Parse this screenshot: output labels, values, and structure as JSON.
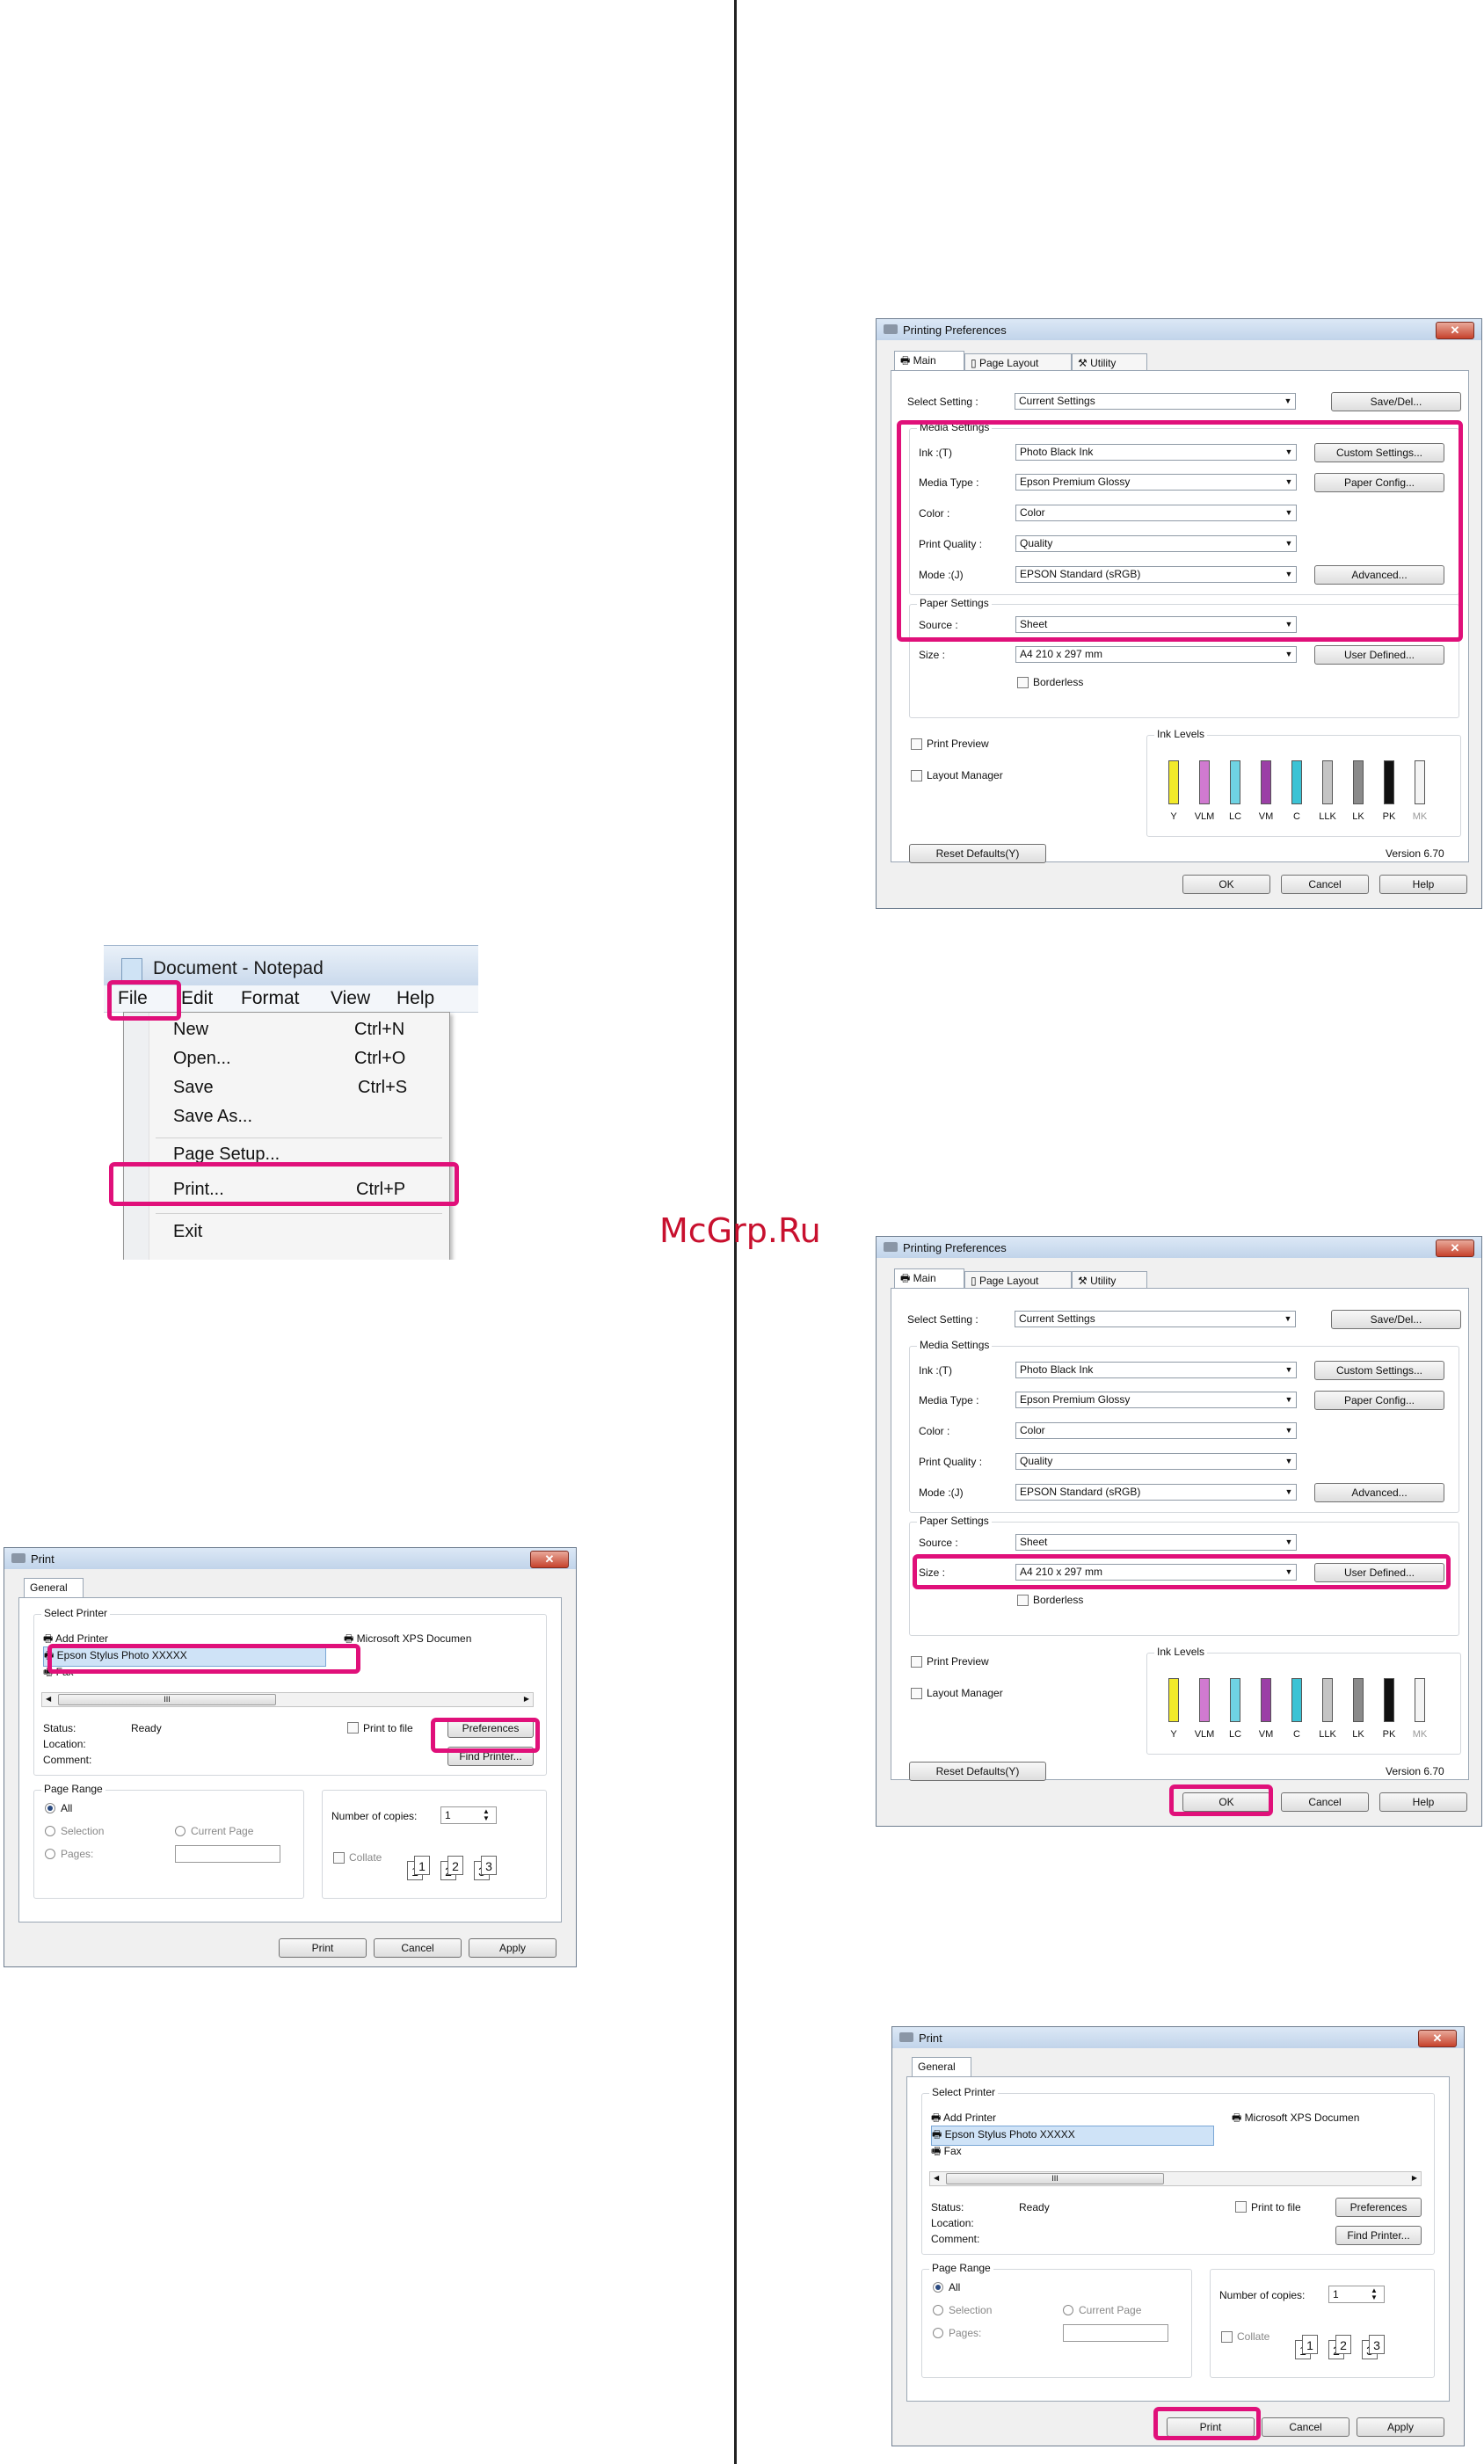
{
  "watermark": "McGrp.Ru",
  "notepad": {
    "title": "Document - Notepad",
    "menus": [
      "File",
      "Edit",
      "Format",
      "View",
      "Help"
    ],
    "items": [
      {
        "label": "New",
        "shortcut": "Ctrl+N"
      },
      {
        "label": "Open...",
        "shortcut": "Ctrl+O"
      },
      {
        "label": "Save",
        "shortcut": "Ctrl+S"
      },
      {
        "label": "Save As...",
        "shortcut": ""
      },
      {
        "label": "Page Setup...",
        "shortcut": ""
      },
      {
        "label": "Print...",
        "shortcut": "Ctrl+P"
      },
      {
        "label": "Exit",
        "shortcut": ""
      }
    ]
  },
  "print_dialog": {
    "title": "Print",
    "tab": "General",
    "select_printer": "Select Printer",
    "printers": [
      "Add Printer",
      "Epson Stylus Photo XXXXX",
      "Fax",
      "Microsoft XPS Documen"
    ],
    "scroll_thumb": "III",
    "status_label": "Status:",
    "status_value": "Ready",
    "location_label": "Location:",
    "comment_label": "Comment:",
    "print_to_file": "Print to file",
    "preferences": "Preferences",
    "find_printer": "Find Printer...",
    "page_range": "Page Range",
    "all": "All",
    "selection": "Selection",
    "current_page": "Current Page",
    "pages": "Pages:",
    "copies_label": "Number of copies:",
    "copies_value": "1",
    "collate": "Collate",
    "page_numbers": [
      "1",
      "1",
      "2",
      "2",
      "3",
      "3"
    ],
    "print_btn": "Print",
    "cancel_btn": "Cancel",
    "apply_btn": "Apply"
  },
  "prefs": {
    "title": "Printing Preferences",
    "tabs": [
      "Main",
      "Page Layout",
      "Utility"
    ],
    "select_setting_label": "Select Setting :",
    "select_setting_value": "Current Settings",
    "save_del": "Save/Del...",
    "media_settings": "Media Settings",
    "ink_label": "Ink :(T)",
    "ink_value": "Photo Black Ink",
    "custom_settings": "Custom Settings...",
    "media_type_label": "Media Type :",
    "media_type_value": "Epson Premium Glossy",
    "paper_config": "Paper Config...",
    "color_label": "Color :",
    "color_value": "Color",
    "quality_label": "Print Quality :",
    "quality_value": "Quality",
    "mode_label": "Mode :(J)",
    "mode_value": "EPSON Standard (sRGB)",
    "advanced": "Advanced...",
    "paper_settings": "Paper Settings",
    "source_label": "Source :",
    "source_value": "Sheet",
    "size_label": "Size :",
    "size_value": "A4 210 x 297 mm",
    "user_defined": "User Defined...",
    "borderless": "Borderless",
    "print_preview": "Print Preview",
    "layout_manager": "Layout Manager",
    "ink_levels": "Ink Levels",
    "inks": [
      {
        "code": "Y",
        "color": "#f2ea2a",
        "level": 0.78
      },
      {
        "code": "VLM",
        "color": "#d07ad0",
        "level": 0.78
      },
      {
        "code": "LC",
        "color": "#6fd3e3",
        "level": 0.78
      },
      {
        "code": "VM",
        "color": "#9b3fa6",
        "level": 0.78
      },
      {
        "code": "C",
        "color": "#3cc3d5",
        "level": 0.78
      },
      {
        "code": "LLK",
        "color": "#c4c4c4",
        "level": 0.78
      },
      {
        "code": "LK",
        "color": "#8a8a8a",
        "level": 0.78
      },
      {
        "code": "PK",
        "color": "#111111",
        "level": 0.78
      },
      {
        "code": "MK",
        "color": "#f4f4f4",
        "level": 0.78
      }
    ],
    "reset_defaults": "Reset Defaults(Y)",
    "version": "Version 6.70",
    "ok": "OK",
    "cancel": "Cancel",
    "help": "Help"
  },
  "highlight_color": "#e0107a"
}
